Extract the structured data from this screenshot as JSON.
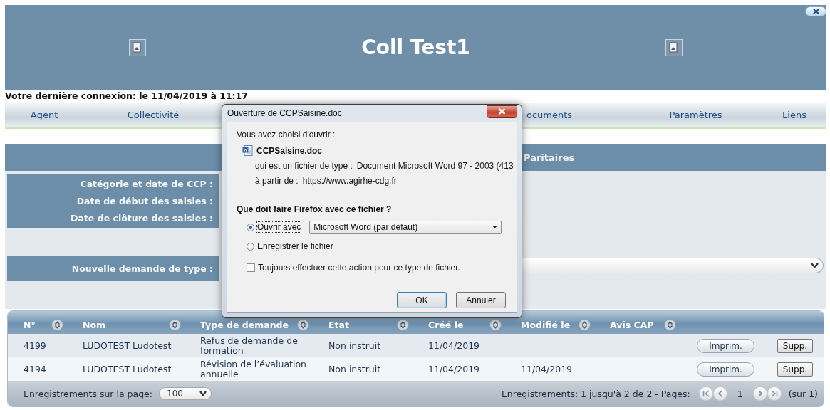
{
  "header": {
    "title": "Coll Test1"
  },
  "last_login": "Votre dernière connexion: le 11/04/2019 à 11:17",
  "nav": [
    {
      "label": "Agent"
    },
    {
      "label": "Collectivité"
    },
    {
      "label": "ocuments"
    },
    {
      "label": "Paramètres"
    },
    {
      "label": "Liens"
    }
  ],
  "section_title": "Paritaires",
  "form": {
    "labels": [
      "Catégorie et date de CCP :",
      "Date de début des saisies :",
      "Date de clôture des saisies :"
    ],
    "new_request_label": "Nouvelle demande de type :"
  },
  "table": {
    "columns": [
      "N°",
      "Nom",
      "Type de demande",
      "Etat",
      "Créé le",
      "Modifié le",
      "Avis CAP"
    ],
    "rows": [
      {
        "number": "4199",
        "name": "LUDOTEST Ludotest",
        "type": "Refus de demande de formation",
        "status": "Non instruit",
        "created": "11/04/2019",
        "print": "Imprim.",
        "delete": "Supp."
      },
      {
        "number": "4194",
        "name": "LUDOTEST Ludotest",
        "type": "Révision de l’évaluation annuelle",
        "status": "Non instruit",
        "created": "11/04/2019",
        "modified": "11/04/2019",
        "print": "Imprim.",
        "delete": "Supp."
      }
    ],
    "footer": {
      "page_size_label": "Enregistrements sur la page:",
      "page_size": "100",
      "records": "Enregistrements: 1 jusqu'à 2 de 2 - Pages:",
      "page": "1",
      "page_total": "(sur 1)"
    }
  },
  "dialog": {
    "title": "Ouverture de CCPSaisine.doc",
    "intro": "Vous avez choisi d'ouvrir :",
    "file_name": "CCPSaisine.doc",
    "type_label": "qui est un fichier de type :",
    "type_value": "Document Microsoft Word 97 - 2003 (413",
    "from_label": "à partir de :",
    "from_value": "https://www.agirhe-cdg.fr",
    "question": "Que doit faire Firefox avec ce fichier ?",
    "options": [
      {
        "label": "Ouvrir avec",
        "selected": true,
        "app": "Microsoft Word (par défaut)"
      },
      {
        "label": "Enregistrer le fichier",
        "selected": false
      }
    ],
    "always": {
      "label": "Toujours effectuer cette action pour ce type de fichier.",
      "checked": false
    },
    "buttons": [
      "OK",
      "Annuler"
    ]
  }
}
